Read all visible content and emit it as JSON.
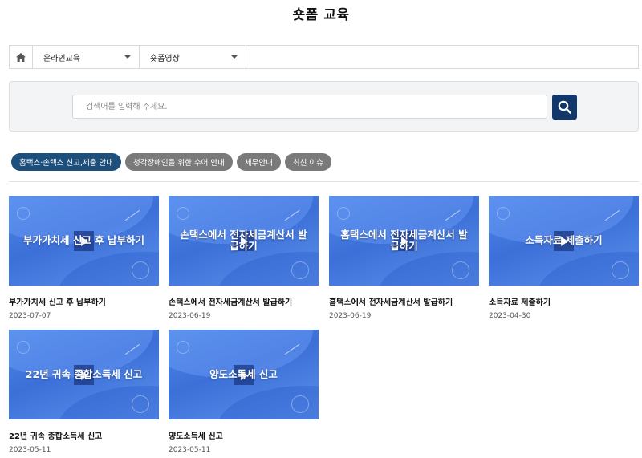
{
  "page": {
    "title": "숏폼 교육"
  },
  "breadcrumb": {
    "home_icon": "home-icon",
    "level1": "온라인교육",
    "level2": "숏폼영상"
  },
  "search": {
    "placeholder": "검색어를 입력해 주세요.",
    "value": "",
    "button_icon": "search-icon",
    "button_color": "#12386b"
  },
  "tabs": [
    {
      "label": "홈택스·손택스 신고,제출 안내",
      "active": true
    },
    {
      "label": "청각장애인을 위한 수어 안내",
      "active": false
    },
    {
      "label": "세무안내",
      "active": false
    },
    {
      "label": "최신 이슈",
      "active": false
    }
  ],
  "colors": {
    "active_tab": "#1d4f7c",
    "inactive_tab": "#7a7a7a"
  },
  "videos": [
    {
      "thumb_text": "부가가치세 신고 후 납부하기",
      "title": "부가가치세 신고 후 납부하기",
      "date": "2023-07-07"
    },
    {
      "thumb_text": "손택스에서 전자세금계산서 발급하기",
      "title": "손택스에서 전자세금계산서 발급하기",
      "date": "2023-06-19"
    },
    {
      "thumb_text": "홈택스에서 전자세금계산서 발급하기",
      "title": "홈택스에서 전자세금계산서 발급하기",
      "date": "2023-06-19"
    },
    {
      "thumb_text": "소득자료 제출하기",
      "title": "소득자료 제출하기",
      "date": "2023-04-30"
    },
    {
      "thumb_text": "22년 귀속 종합소득세 신고",
      "title": "22년 귀속 종합소득세 신고",
      "date": "2023-05-11"
    },
    {
      "thumb_text": "양도소득세 신고",
      "title": "양도소득세 신고",
      "date": "2023-05-11"
    }
  ]
}
